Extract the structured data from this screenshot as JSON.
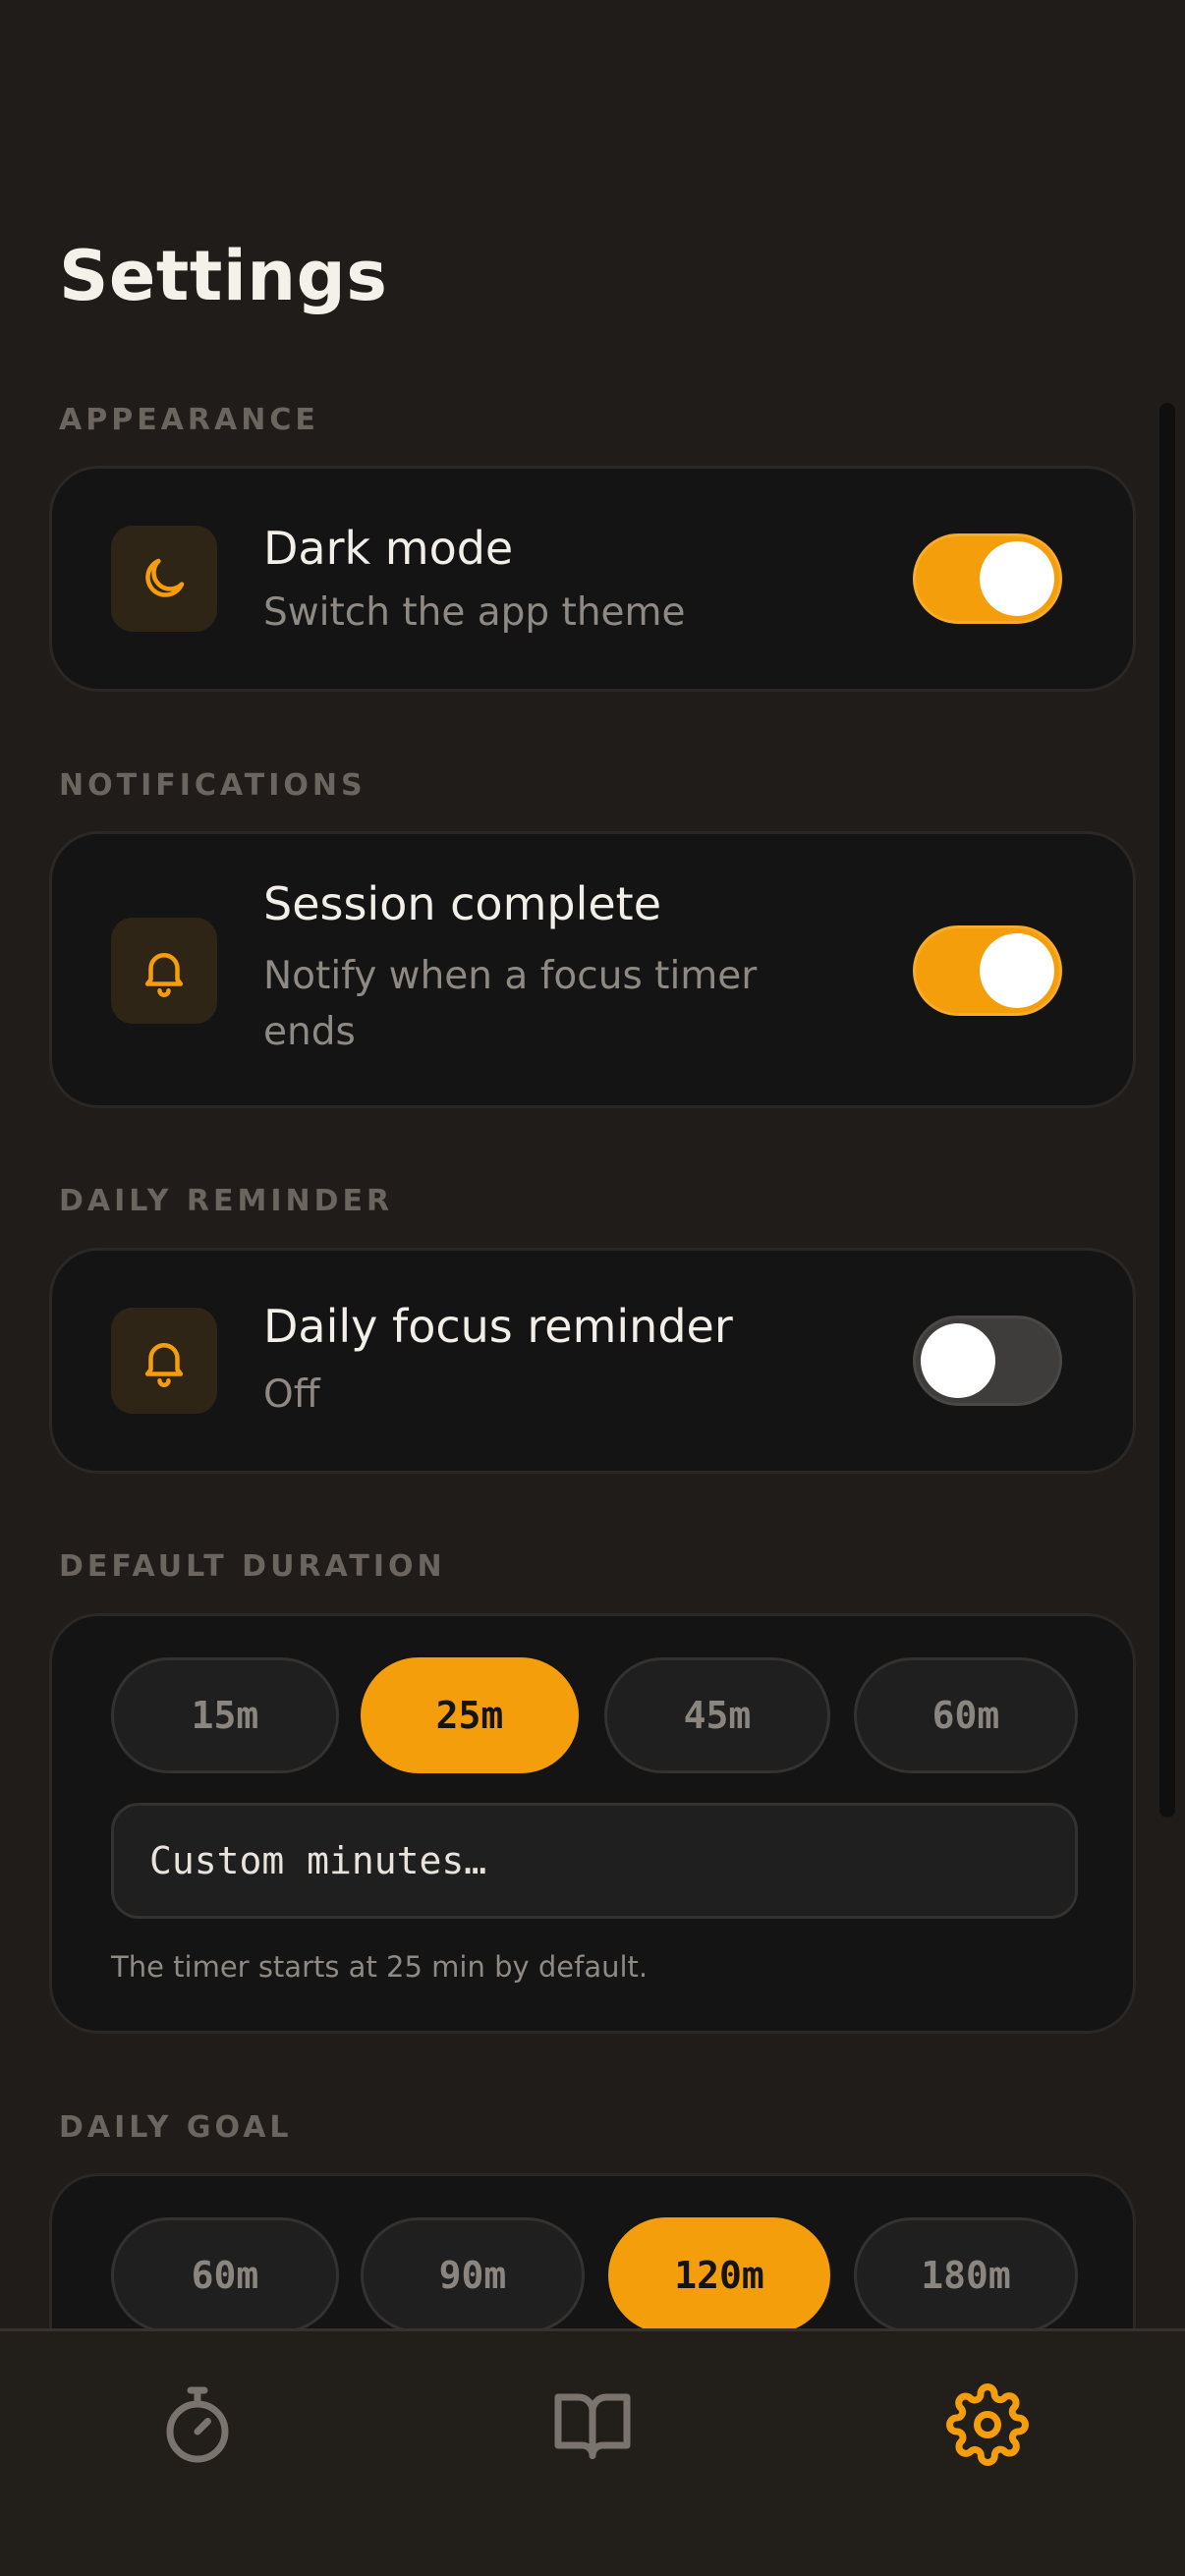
{
  "page": {
    "title": "Settings"
  },
  "appearance": {
    "label": "APPEARANCE",
    "dark_mode": {
      "title": "Dark mode",
      "subtitle": "Switch the app theme",
      "enabled": true,
      "icon": "moon-icon"
    }
  },
  "notifications": {
    "label": "NOTIFICATIONS",
    "session_complete": {
      "title": "Session complete",
      "subtitle": "Notify when a focus timer ends",
      "enabled": true,
      "icon": "bell-icon"
    }
  },
  "daily_reminder": {
    "label": "DAILY REMINDER",
    "reminder": {
      "title": "Daily focus reminder",
      "subtitle": "Off",
      "enabled": false,
      "icon": "bell-icon"
    }
  },
  "default_duration": {
    "label": "DEFAULT DURATION",
    "options": [
      "15m",
      "25m",
      "45m",
      "60m"
    ],
    "selected": "25m",
    "custom_placeholder": "Custom minutes…",
    "hint": "The timer starts at 25 min by default."
  },
  "daily_goal": {
    "label": "DAILY GOAL",
    "options": [
      "60m",
      "90m",
      "120m",
      "180m"
    ],
    "selected": "120m"
  },
  "bottom_nav": {
    "items": [
      {
        "name": "timer",
        "icon": "stopwatch-icon",
        "active": false
      },
      {
        "name": "library",
        "icon": "book-icon",
        "active": false
      },
      {
        "name": "settings",
        "icon": "gear-icon",
        "active": true
      }
    ]
  },
  "colors": {
    "accent": "#f59e0b",
    "background": "#1f1c1a",
    "card": "#141414",
    "muted_text": "#8f8983",
    "inactive_icon": "#7a746e"
  }
}
